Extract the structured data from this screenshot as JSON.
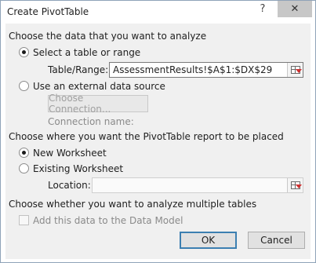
{
  "window": {
    "title": "Create PivotTable",
    "help_label": "?",
    "close_label": "✕"
  },
  "section1": {
    "heading": "Choose the data that you want to analyze",
    "select_table_label": "Select a table or range",
    "table_range_label": "Table/Range:",
    "table_range_value": "AssessmentResults!$A$1:$DX$29",
    "external_source_label": "Use an external data source",
    "choose_connection_label": "Choose Connection...",
    "connection_name_label": "Connection name:"
  },
  "section2": {
    "heading": "Choose where you want the PivotTable report to be placed",
    "new_worksheet_label": "New Worksheet",
    "existing_worksheet_label": "Existing Worksheet",
    "location_label": "Location:",
    "location_value": ""
  },
  "section3": {
    "heading": "Choose whether you want to analyze multiple tables",
    "data_model_label": "Add this data to the Data Model"
  },
  "buttons": {
    "ok_label": "OK",
    "cancel_label": "Cancel"
  },
  "state": {
    "selected_source": "select-table-or-range",
    "selected_destination": "new-worksheet",
    "data_model_checked": false
  }
}
